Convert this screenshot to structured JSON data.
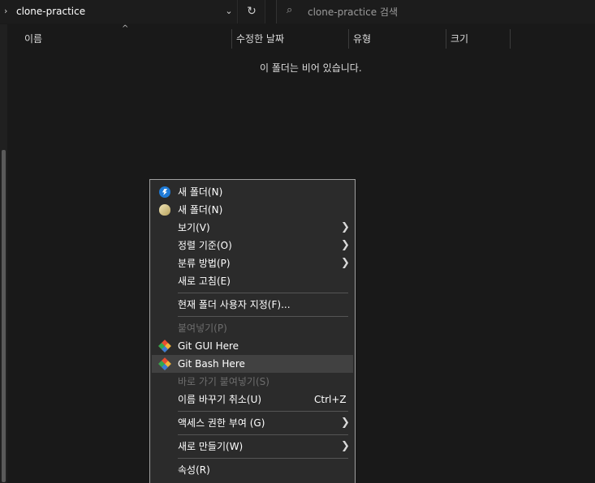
{
  "address": {
    "chevron": "›",
    "path": "clone-practice",
    "dropdown": "⌄",
    "refresh": "↻"
  },
  "search": {
    "icon": "search-icon",
    "placeholder": "clone-practice 검색"
  },
  "columns": {
    "name": "이름",
    "modified": "수정한 날짜",
    "type": "유형",
    "size": "크기",
    "sort_caret": "^"
  },
  "content": {
    "empty_message": "이 폴더는 비어 있습니다."
  },
  "menu": {
    "items": [
      {
        "label": "새 폴더(N)",
        "icon": "bolt-folder-icon"
      },
      {
        "label": "새 폴더(N)",
        "icon": "egg-icon"
      },
      {
        "label": "보기(V)",
        "arrow": "❯"
      },
      {
        "label": "정렬 기준(O)",
        "arrow": "❯"
      },
      {
        "label": "분류 방법(P)",
        "arrow": "❯"
      },
      {
        "label": "새로 고침(E)"
      },
      {
        "label": "현재 폴더 사용자 지정(F)..."
      },
      {
        "label": "붙여넣기(P)",
        "disabled": true
      },
      {
        "label": "Git GUI Here",
        "icon": "git-icon"
      },
      {
        "label": "Git Bash Here",
        "icon": "git-icon",
        "hover": true
      },
      {
        "label": "바로 가기 붙여넣기(S)",
        "disabled": true
      },
      {
        "label": "이름 바꾸기 취소(U)",
        "shortcut": "Ctrl+Z"
      },
      {
        "label": "액세스 권한 부여 (G)",
        "arrow": "❯"
      },
      {
        "label": "새로 만들기(W)",
        "arrow": "❯"
      },
      {
        "label": "속성(R)"
      }
    ]
  },
  "colors": {
    "background": "#191919",
    "menu_bg": "#2b2b2b",
    "menu_hover": "#414141",
    "disabled_text": "#6d6d6d"
  }
}
